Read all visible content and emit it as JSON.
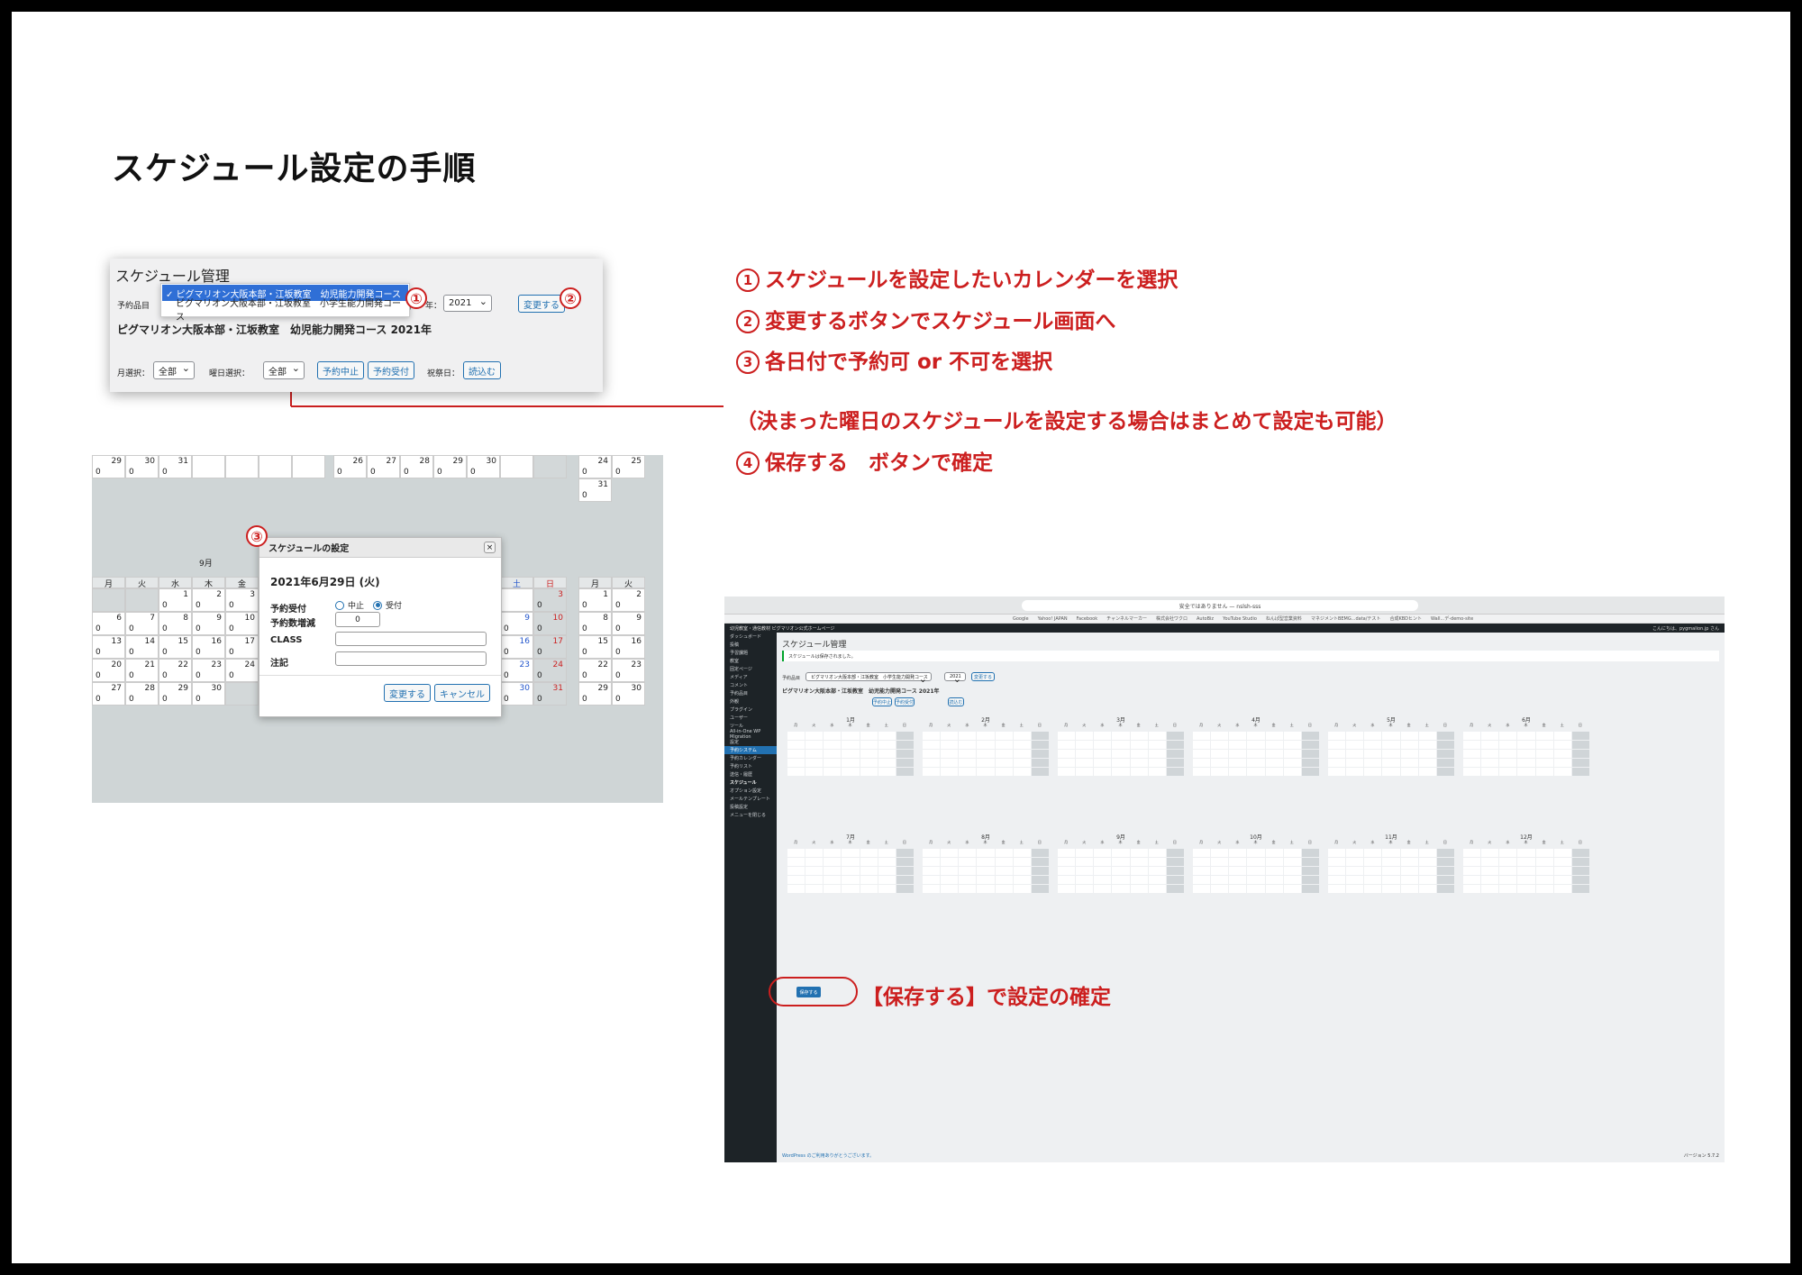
{
  "title": "スケジュール設定の手順",
  "steps": [
    {
      "num": "①",
      "text": "スケジュールを設定したいカレンダーを選択"
    },
    {
      "num": "②",
      "text": "変更するボタンでスケジュール画面へ"
    },
    {
      "num": "③",
      "text": "各日付で予約可 or 不可を選択"
    },
    {
      "num": "",
      "text": "（決まった曜日のスケジュールを設定する場合はまとめて設定も可能）"
    },
    {
      "num": "④",
      "text": "保存する　ボタンで確定"
    }
  ],
  "save_note": "【保存する】で設定の確定",
  "markers": {
    "m1": "①",
    "m2": "②",
    "m3": "③"
  },
  "panel1": {
    "title": "スケジュール管理",
    "item_label": "予約品目",
    "dropdown": {
      "selected": "✓ ピグマリオン大阪本部・江坂教室　幼児能力開発コース",
      "option2": "ピグマリオン大阪本部・江坂教室　小学生能力開発コース"
    },
    "year_label": "年：",
    "year_value": "2021",
    "change_button": "変更する",
    "subtitle": "ピグマリオン大阪本部・江坂教室　幼児能力開発コース 2021年",
    "month_label": "月選択：",
    "month_value": "全部",
    "weekday_label": "曜日選択：",
    "weekday_value": "全部",
    "stop_button": "予約中止",
    "accept_button": "予約受付",
    "holiday_label": "祝祭日：",
    "load_button": "読込む"
  },
  "panel2": {
    "month_title": "9月",
    "weekdays": [
      "月",
      "火",
      "水",
      "木",
      "金",
      "土",
      "日"
    ],
    "right_weekdays": [
      "月",
      "火"
    ],
    "modal": {
      "title": "スケジュールの設定",
      "close": "×",
      "date": "2021年6月29日 (火)",
      "reserve_label": "予約受付",
      "option_stop": "中止",
      "option_accept": "受付",
      "count_label": "予約数増減",
      "count_value": "0",
      "class_label": "CLASS",
      "note_label": "注記",
      "change_button": "変更する",
      "cancel_button": "キャンセル"
    }
  },
  "panel3": {
    "url": "安全ではありません — nslsh-sss",
    "bookmarks": [
      "Google",
      "Yahoo! JAPAN",
      "Facebook",
      "チャンネルマーカー",
      "株式会社ワクロ",
      "AutoBiz",
      "YouTube Studio",
      "ねんぱ型営業資料",
      "マネジメントBEMG...data/テスト",
      "合成KBDヒント",
      "Wall...デ-demo-site"
    ],
    "admin_left": "幼児教室・通信教材 ピグマリオン公式ホームページ",
    "admin_right": "こんにちは、pygmalion.jp さん",
    "sidebar": [
      "ダッシュボード",
      "投稿",
      "予習課題",
      "教室",
      "固定ページ",
      "メディア",
      "コメント",
      "予約品目",
      "外観",
      "プラグイン",
      "ユーザー",
      "ツール",
      "All-in-One WP Migration",
      "設定",
      "予約システム",
      "予約カレンダー",
      "予約リスト",
      "送信・履歴",
      "スケジュール",
      "オプション設定",
      "メールテンプレート",
      "投稿設定",
      "メニューを閉じる"
    ],
    "heading": "スケジュール管理",
    "notice": "スケジュールは保存されました。",
    "subtitle": "ピグマリオン大阪本部・江坂教室　幼児能力開発コース 2021年",
    "months": [
      "1月",
      "2月",
      "3月",
      "4月",
      "5月",
      "6月",
      "7月",
      "8月",
      "9月",
      "10月",
      "11月",
      "12月"
    ],
    "save_button": "保存する",
    "footer_left": "WordPress のご利用ありがとうございます。",
    "footer_right": "バージョン 5.7.2"
  }
}
